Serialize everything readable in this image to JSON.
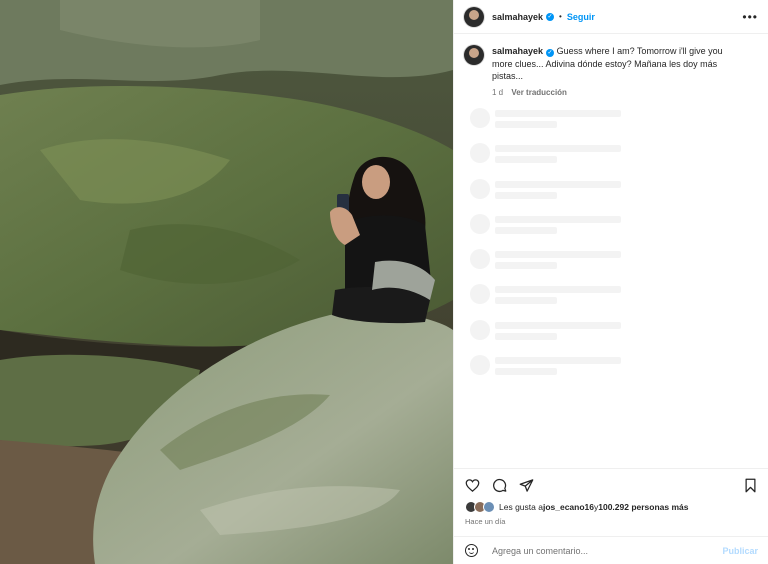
{
  "post": {
    "username": "salmahayek",
    "follow_label": "Seguir",
    "more_label": "•••",
    "caption": "Guess where I am? Tomorrow i'll give you more clues... Adivina dónde estoy? Mañana les doy más pistas...",
    "caption_time": "1 d",
    "translate_label": "Ver traducción",
    "likes_prefix": "Les gusta a ",
    "likes_user": "jos_ecano16",
    "likes_middle": " y ",
    "likes_count": "100.292 personas más",
    "posted_ago": "Hace un día",
    "comment_placeholder": "Agrega un comentario...",
    "publish_label": "Publicar"
  },
  "colors": {
    "accent": "#0095f6",
    "publish_disabled": "#b3dbff"
  },
  "icons": [
    "heart-icon",
    "comment-icon",
    "share-icon",
    "bookmark-icon",
    "emoji-icon",
    "verified-icon"
  ]
}
